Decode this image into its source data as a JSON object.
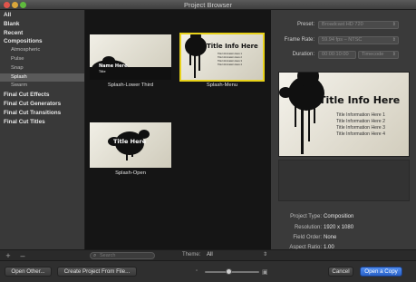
{
  "window": {
    "title": "Project Browser"
  },
  "sidebar": {
    "items": [
      {
        "label": "All",
        "level": 0,
        "selected": false
      },
      {
        "label": "Blank",
        "level": 0,
        "selected": false
      },
      {
        "label": "Recent",
        "level": 0,
        "selected": false
      },
      {
        "label": "Compositions",
        "level": 0,
        "selected": false
      },
      {
        "label": "Atmospheric",
        "level": 1,
        "selected": false
      },
      {
        "label": "Pulse",
        "level": 1,
        "selected": false
      },
      {
        "label": "Snap",
        "level": 1,
        "selected": false
      },
      {
        "label": "Splash",
        "level": 1,
        "selected": true
      },
      {
        "label": "Swarm",
        "level": 1,
        "selected": false
      },
      {
        "label": "Final Cut Effects",
        "level": 0,
        "selected": false
      },
      {
        "label": "Final Cut Generators",
        "level": 0,
        "selected": false
      },
      {
        "label": "Final Cut Transitions",
        "level": 0,
        "selected": false
      },
      {
        "label": "Final Cut Titles",
        "level": 0,
        "selected": false
      }
    ],
    "add_label": "+",
    "remove_label": "–"
  },
  "templates": [
    {
      "caption": "Splash-Lower Third",
      "thumb_title": "Name Here",
      "thumb_sub": "Title",
      "selected": false
    },
    {
      "caption": "Splash-Menu",
      "thumb_title": "Title Info Here",
      "thumb_lines": [
        "Title Information Here 1",
        "Title Information Here 2",
        "Title Information Here 3",
        "Title Information Here 4"
      ],
      "selected": true
    },
    {
      "caption": "Splash-Open",
      "thumb_title": "Title Here",
      "selected": false
    }
  ],
  "search": {
    "placeholder": "Search",
    "value": ""
  },
  "theme": {
    "label": "Theme:",
    "value": "All"
  },
  "settings": {
    "preset_label": "Preset:",
    "preset_value": "Broadcast HD 720",
    "frame_rate_label": "Frame Rate:",
    "frame_rate_value": "59.94 fps – NTSC",
    "duration_label": "Duration:",
    "duration_value": "00:00:10:00",
    "duration_unit": "Timecode"
  },
  "preview": {
    "title": "Title Info Here",
    "lines": [
      "Title Information Here 1",
      "Title Information Here 2",
      "Title Information Here 3",
      "Title Information Here 4"
    ]
  },
  "info": {
    "project_type_label": "Project Type:",
    "project_type_value": "Composition",
    "resolution_label": "Resolution:",
    "resolution_value": "1920 x 1080",
    "field_order_label": "Field Order:",
    "field_order_value": "None",
    "aspect_ratio_label": "Aspect Ratio:",
    "aspect_ratio_value": "1.00"
  },
  "footer": {
    "open_other_label": "Open Other...",
    "create_from_file_label": "Create Project From File...",
    "cancel_label": "Cancel",
    "open_copy_label": "Open a Copy",
    "zoom_level": 0.45
  },
  "colors": {
    "selection": "#e8d21a",
    "primary_button": "#3b78e0"
  }
}
